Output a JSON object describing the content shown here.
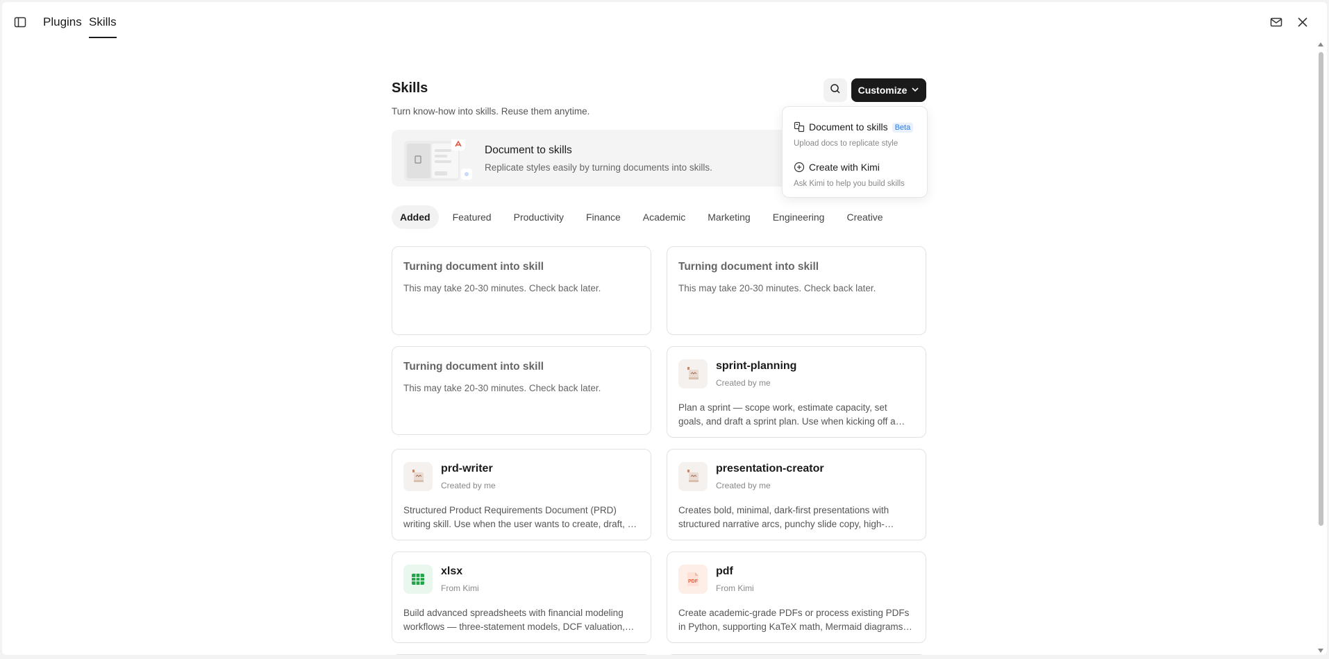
{
  "header": {
    "tabs": [
      {
        "label": "Plugins",
        "active": false
      },
      {
        "label": "Skills",
        "active": true
      }
    ],
    "icons": [
      "sidebar-toggle-icon",
      "mail-icon",
      "close-icon"
    ]
  },
  "page": {
    "title": "Skills",
    "subtitle": "Turn know-how into skills. Reuse them anytime.",
    "customize_label": "Customize"
  },
  "banner": {
    "title": "Document to skills",
    "description": "Replicate styles easily by turning documents into skills."
  },
  "dropdown": {
    "items": [
      {
        "label": "Document to skills",
        "badge": "Beta",
        "sub": "Upload docs to replicate style",
        "icon": "document-convert-icon"
      },
      {
        "label": "Create with Kimi",
        "sub": "Ask Kimi to help you build skills",
        "icon": "plus-circle-icon"
      }
    ]
  },
  "categories": [
    {
      "label": "Added",
      "active": true
    },
    {
      "label": "Featured"
    },
    {
      "label": "Productivity"
    },
    {
      "label": "Finance"
    },
    {
      "label": "Academic"
    },
    {
      "label": "Marketing"
    },
    {
      "label": "Engineering"
    },
    {
      "label": "Creative"
    }
  ],
  "pending_cards": [
    {
      "title": "Turning document into skill",
      "desc": "This may take 20-30 minutes. Check back later."
    },
    {
      "title": "Turning document into skill",
      "desc": "This may take 20-30 minutes. Check back later."
    },
    {
      "title": "Turning document into skill",
      "desc": "This may take 20-30 minutes. Check back later."
    }
  ],
  "skills": [
    {
      "name": "sprint-planning",
      "author": "Created by me",
      "icon": "custom-skill-icon",
      "desc": "Plan a sprint — scope work, estimate capacity, set goals, and draft a sprint plan. Use when kicking off a new sprint, sizing a backlog against team availability."
    },
    {
      "name": "prd-writer",
      "author": "Created by me",
      "icon": "custom-skill-icon",
      "desc": "Structured Product Requirements Document (PRD) writing skill. Use when the user wants to create, draft, or refine a product requirements document."
    },
    {
      "name": "presentation-creator",
      "author": "Created by me",
      "icon": "custom-skill-icon",
      "desc": "Creates bold, minimal, dark-first presentations with structured narrative arcs, punchy slide copy, high-contrast visuals and speaker notes."
    },
    {
      "name": "xlsx",
      "author": "From Kimi",
      "icon": "spreadsheet-icon",
      "desc": "Build advanced spreadsheets with financial modeling workflows — three-statement models, DCF valuation, sensitivity tables and charts."
    },
    {
      "name": "pdf",
      "author": "From Kimi",
      "icon": "pdf-icon",
      "desc": "Create academic-grade PDFs or process existing PDFs in Python, supporting KaTeX math, Mermaid diagrams, tables and citations."
    }
  ],
  "colors": {
    "accent_dark": "#1a1a1a",
    "beta_badge": "#2a7be4",
    "xlsx_green": "#22a34a",
    "pdf_red": "#e8613f"
  }
}
